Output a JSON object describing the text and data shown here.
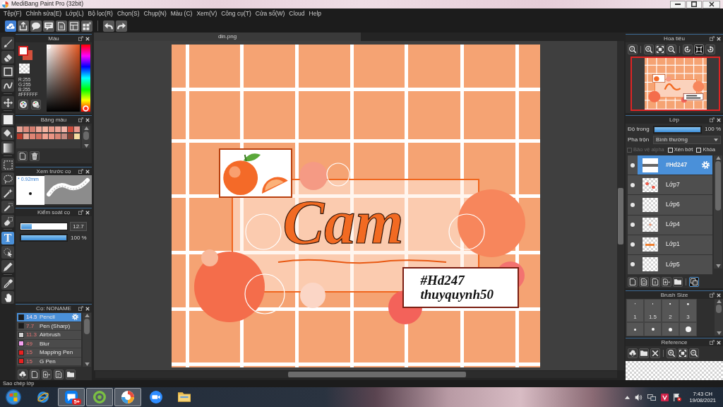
{
  "window": {
    "title": "MediBang Paint Pro (32bit)"
  },
  "menu": [
    "Tệp(F)",
    "Chỉnh sửa(E)",
    "Lớp(L)",
    "Bộ lọc(R)",
    "Chọn(S)",
    "Chụp(N)",
    "Màu (C)",
    "Xem(V)",
    "Công cụ(T)",
    "Cửa sổ(W)",
    "Cloud",
    "Help"
  ],
  "toolbar": [
    {
      "buttons": [
        {
          "kind": "cloud"
        },
        {
          "kind": "upload"
        },
        {
          "kind": "speech"
        },
        {
          "kind": "note"
        },
        {
          "kind": "page-lines"
        },
        {
          "kind": "layout"
        },
        {
          "kind": "grid"
        }
      ]
    },
    {
      "buttons": [
        {
          "kind": "undo"
        },
        {
          "kind": "redo"
        }
      ]
    }
  ],
  "tool_groups": [
    {
      "tools": [
        {
          "kind": "brush",
          "selected": false
        },
        {
          "kind": "eraser",
          "selected": false
        },
        {
          "kind": "square",
          "selected": false
        },
        {
          "kind": "curve",
          "selected": false
        }
      ]
    },
    {
      "tools": [
        {
          "kind": "move",
          "selected": false
        }
      ]
    },
    {
      "tools": [
        {
          "kind": "filled-square",
          "selected": false
        },
        {
          "kind": "bucket",
          "selected": false
        },
        {
          "kind": "gradient",
          "selected": false
        }
      ]
    },
    {
      "tools": [
        {
          "kind": "dotted-square",
          "selected": false
        },
        {
          "kind": "lasso",
          "selected": false
        },
        {
          "kind": "wand",
          "selected": false
        },
        {
          "kind": "pen-select",
          "selected": false
        },
        {
          "kind": "eraser-select",
          "selected": false
        }
      ]
    },
    {
      "tools": [
        {
          "kind": "text",
          "selected": true,
          "glyph": "T"
        },
        {
          "kind": "pointer",
          "selected": false
        },
        {
          "kind": "pen",
          "selected": false
        }
      ]
    },
    {
      "tools": [
        {
          "kind": "dropper",
          "selected": false
        },
        {
          "kind": "hand",
          "selected": false
        }
      ]
    }
  ],
  "left_panels": {
    "color": {
      "title": "Màu",
      "swatches": [
        {
          "kind": "foreground",
          "color": "#ffffff"
        },
        {
          "kind": "background",
          "color": "#d4503c"
        },
        {
          "kind": "transparent"
        }
      ],
      "values": [
        "R:255",
        "G:255",
        "B:255",
        "#FFFFFF"
      ],
      "hue": {
        "level": 0
      },
      "buttons": [
        {
          "kind": "palette"
        },
        {
          "kind": "palette-gear"
        }
      ]
    },
    "palette": {
      "title": "Bảng màu",
      "colors": [
        {
          "color": "#e8a294"
        },
        {
          "color": "#dc8a7c"
        },
        {
          "color": "#d47e70"
        },
        {
          "color": "#eea898"
        },
        {
          "color": "#f2b2a0"
        },
        {
          "color": "#e89a8a"
        },
        {
          "color": "#eca496"
        },
        {
          "color": "#f2b4a8"
        },
        {
          "color": "#cc4c3c"
        },
        {
          "color": "#e8988c"
        },
        {
          "color": "#b83c2c"
        },
        {
          "color": "#e6a290"
        },
        {
          "color": "#de8474"
        },
        {
          "color": "#d27262"
        },
        {
          "color": "#f0a290"
        },
        {
          "color": "#ea9484"
        },
        {
          "color": "#d88474"
        },
        {
          "color": "#c48a80"
        },
        {
          "color": "#7c4034"
        },
        {
          "color": "#f6dca0"
        }
      ],
      "buttons": [
        {
          "kind": "page"
        },
        {
          "kind": "trash"
        }
      ]
    },
    "brush_preview": {
      "title": "Xem trước cọ",
      "size": "* 0.92mm"
    },
    "brush_control": {
      "title": "Kiểm soát cọ",
      "sliders": [
        {
          "kind": "size",
          "level": 0.24,
          "reading": "12.7"
        },
        {
          "kind": "opacity",
          "level": 1,
          "reading": "100 %"
        }
      ]
    },
    "brushes": {
      "title": "Cọ: NONAME",
      "items": [
        {
          "size": "14.5",
          "name": "Pencil",
          "color": "#1c1c1c",
          "selected": true
        },
        {
          "size": "7.7",
          "name": "Pen (Sharp)",
          "color": "#1c1c1c",
          "selected": false
        },
        {
          "size": "11.3",
          "name": "Airbrush",
          "color": "#d2d2d2",
          "selected": false
        },
        {
          "size": "49",
          "name": "Blur",
          "color": "#f4a0f0",
          "selected": false
        },
        {
          "size": "15",
          "name": "Mapping Pen",
          "color": "#e82020",
          "selected": false
        },
        {
          "size": "15",
          "name": "G Pen",
          "color": "#e82020",
          "selected": false
        }
      ],
      "buttons": [
        {
          "kind": "cloud-down"
        },
        {
          "kind": "page"
        },
        {
          "kind": "page-add"
        },
        {
          "kind": "page-edit"
        },
        {
          "kind": "folder"
        }
      ]
    }
  },
  "canvas": {
    "tab": "din.png",
    "lettering": "Cam",
    "caption": [
      "#Hd247",
      "thuyquynh50"
    ]
  },
  "right_panels": {
    "navigator": {
      "title": "Hoa tiêu",
      "button_groups": [
        {
          "buttons": [
            {
              "kind": "zoom-actual",
              "selected": false
            }
          ]
        },
        {
          "buttons": [
            {
              "kind": "zoom-in",
              "selected": false
            },
            {
              "kind": "fit",
              "selected": false
            },
            {
              "kind": "zoom-out",
              "selected": false
            }
          ]
        },
        {
          "buttons": [
            {
              "kind": "rotate-left",
              "selected": false
            },
            {
              "kind": "fit-screen",
              "selected": true
            },
            {
              "kind": "rotate-right",
              "selected": false
            }
          ]
        }
      ]
    },
    "layers": {
      "title": "Lớp",
      "opacity": {
        "label": "Độ trong",
        "level": 1,
        "reading": "100 %"
      },
      "blend": {
        "label": "Pha trộn",
        "value": "Bình thường"
      },
      "options": [
        {
          "label": "Bảo vệ alpha",
          "checked": false,
          "disabled": true
        },
        {
          "label": "Xén bớt",
          "checked": false,
          "disabled": false
        },
        {
          "label": "Khóa",
          "checked": false,
          "disabled": false
        }
      ],
      "layers": [
        {
          "name": "#Hd247",
          "kind": "text",
          "selected": true,
          "visible": true
        },
        {
          "name": "Lớp7",
          "kind": "dots",
          "selected": false,
          "visible": true
        },
        {
          "name": "Lớp6",
          "kind": "blank",
          "selected": false,
          "visible": true
        },
        {
          "name": "Lớp4",
          "kind": "marks",
          "selected": false,
          "visible": true
        },
        {
          "name": "Lớp1",
          "kind": "scribble",
          "selected": false,
          "visible": true
        },
        {
          "name": "Lớp5",
          "kind": "blank",
          "selected": false,
          "visible": true
        }
      ],
      "button_groups": [
        {
          "buttons": [
            {
              "kind": "page",
              "selected": false
            },
            {
              "kind": "page-stack",
              "selected": false
            },
            {
              "kind": "page-mark",
              "selected": false
            },
            {
              "kind": "page-add",
              "selected": false
            },
            {
              "kind": "folder",
              "selected": false
            }
          ]
        },
        {
          "buttons": [
            {
              "kind": "copy",
              "selected": true
            }
          ]
        }
      ]
    },
    "brush_size": {
      "title": "Brush Size",
      "sizes": [
        "1",
        "1.5",
        "2",
        "3"
      ]
    },
    "reference": {
      "title": "Reference",
      "button_groups": [
        {
          "buttons": [
            {
              "kind": "cloud-down"
            },
            {
              "kind": "folder"
            },
            {
              "kind": "close"
            }
          ]
        },
        {
          "buttons": [
            {
              "kind": "zoom-in"
            },
            {
              "kind": "fit"
            },
            {
              "kind": "zoom-out"
            }
          ]
        }
      ]
    }
  },
  "status_bar": "Sao chép lớp",
  "taskbar": {
    "apps": [
      {
        "kind": "ie",
        "running": false
      },
      {
        "kind": "zalo",
        "running": true,
        "badge": "5+"
      },
      {
        "kind": "ring",
        "running": true
      },
      {
        "kind": "medibang",
        "running": true
      },
      {
        "kind": "video",
        "running": false
      },
      {
        "kind": "folder",
        "running": false
      }
    ],
    "clock": {
      "time": "7:43 CH",
      "date": "19/08/2021"
    }
  }
}
